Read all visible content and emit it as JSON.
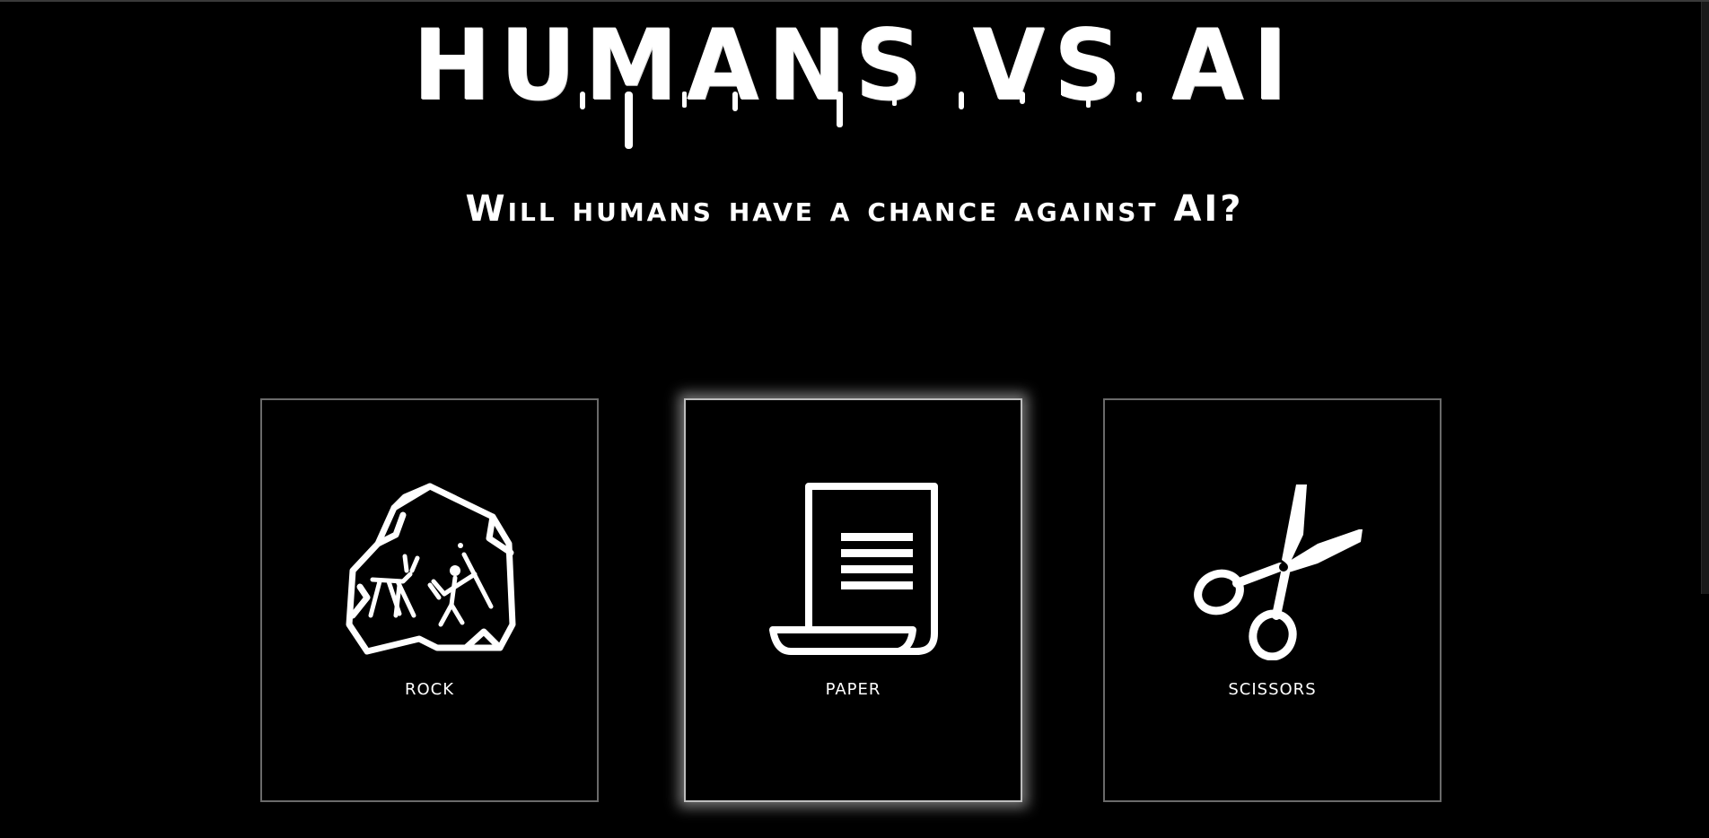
{
  "header": {
    "title": "HUMANS VS AI",
    "subtitle": "Will humans have a chance against AI?"
  },
  "choices": [
    {
      "label": "ROCK",
      "icon": "rock-cave-painting-icon"
    },
    {
      "label": "PAPER",
      "icon": "paper-scroll-icon"
    },
    {
      "label": "SCISSORS",
      "icon": "scissors-icon"
    }
  ],
  "selected_choice": "PAPER",
  "colors": {
    "background": "#000000",
    "text": "#ffffff",
    "card_border": "#6a6a6a",
    "highlight_glow": "#ffffff"
  }
}
